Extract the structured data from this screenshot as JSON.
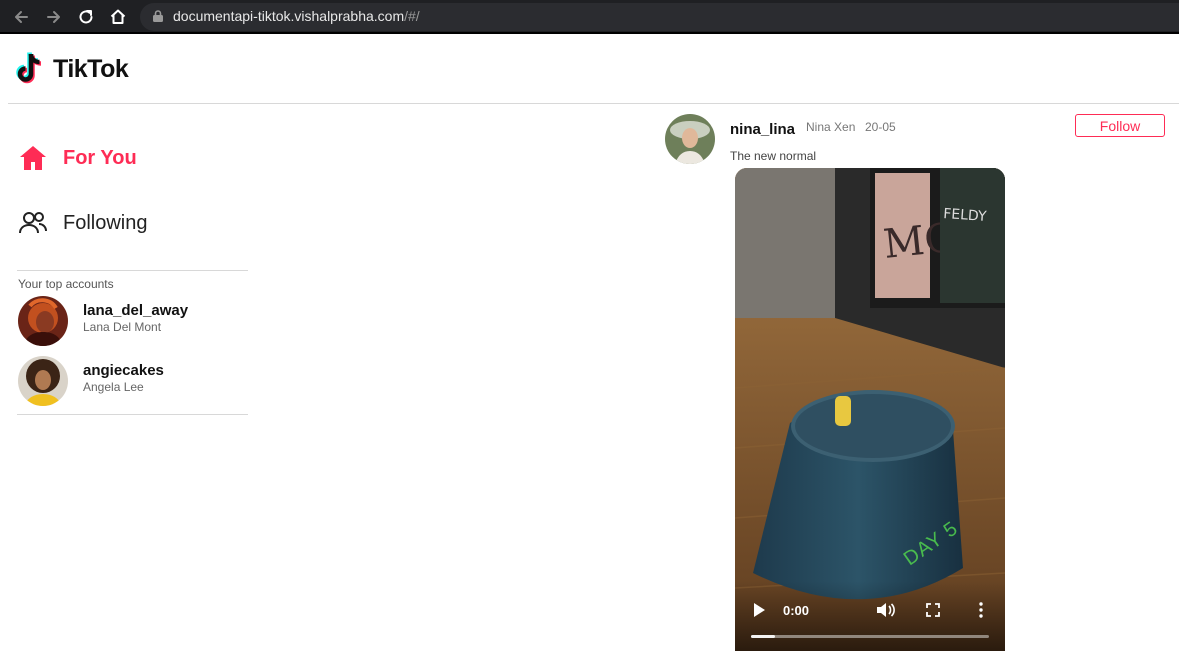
{
  "browser": {
    "url_main": "documentapi-tiktok.vishalprabha.com",
    "url_rest": "/#/"
  },
  "header": {
    "logo_text": "TikTok"
  },
  "sidebar": {
    "items": [
      {
        "label": "For You",
        "icon": "home-icon",
        "active": true
      },
      {
        "label": "Following",
        "icon": "users-icon",
        "active": false
      }
    ],
    "section_title": "Your top accounts",
    "accounts": [
      {
        "username": "lana_del_away",
        "name": "Lana Del Mont"
      },
      {
        "username": "angiecakes",
        "name": "Angela Lee"
      }
    ]
  },
  "post": {
    "username": "nina_lina",
    "name": "Nina Xen",
    "date": "20-05",
    "follow_label": "Follow",
    "caption": "The new normal",
    "video": {
      "time": "0:00",
      "progress": 0.1,
      "sticker_text": "DAY 5"
    }
  },
  "colors": {
    "accent": "#fe2c55",
    "browser_bg": "#1f2023"
  }
}
